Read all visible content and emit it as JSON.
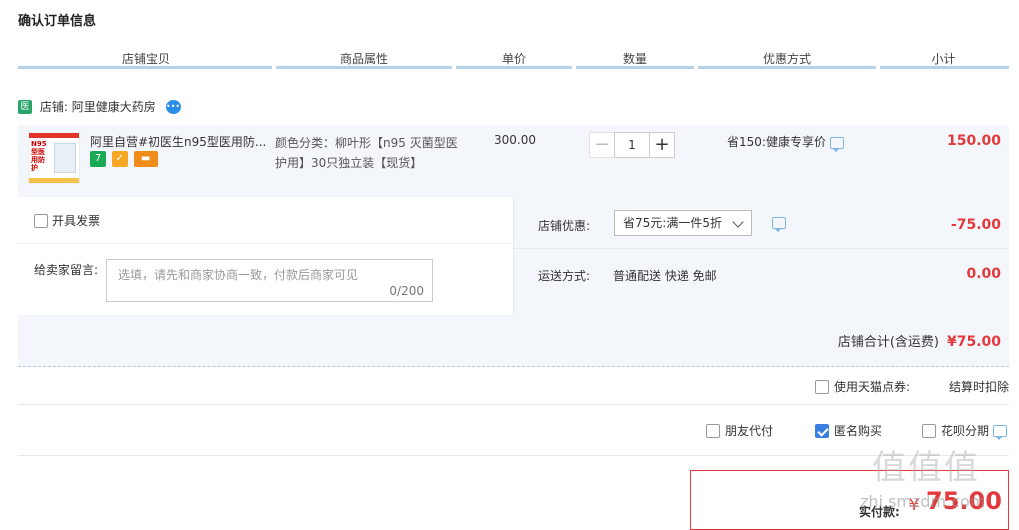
{
  "page_title": "确认订单信息",
  "columns": [
    "店铺宝贝",
    "商品属性",
    "单价",
    "数量",
    "优惠方式",
    "小计"
  ],
  "shop": {
    "badge": "医",
    "label": "店铺:",
    "name": "阿里健康大药房"
  },
  "item": {
    "title": "阿里自营#初医生n95型医用防...",
    "thumb_text": "N95型医用防护",
    "attributes": "颜色分类：柳叶形【n95 灭菌型医护用】30只独立装【现货】",
    "price": "300.00",
    "quantity": "1",
    "minus": "−",
    "plus": "+",
    "promotion": "省150:健康专享价",
    "subtotal": "150.00",
    "icons": [
      "7",
      "✓",
      "▬"
    ]
  },
  "invoice": {
    "label": "开具发票"
  },
  "memo": {
    "label": "给卖家留言:",
    "placeholder": "选填，请先和商家协商一致，付款后商家可见",
    "count": "0/200"
  },
  "discount": {
    "label": "店铺优惠:",
    "selected": "省75元:满一件5折",
    "value": "-75.00"
  },
  "shipping": {
    "label": "运送方式:",
    "method": "普通配送 快递 免邮",
    "value": "0.00"
  },
  "shop_total": {
    "label": "店铺合计(含运费)",
    "value": "¥75.00"
  },
  "tmall_points": {
    "label": "使用天猫点券:",
    "status": "结算时扣除"
  },
  "options": {
    "friend_pay": "朋友代付",
    "anonymous": "匿名购买",
    "huabei": "花呗分期"
  },
  "payment": {
    "label": "实付款:",
    "currency": "¥",
    "value": "75.00"
  },
  "watermark": {
    "big": "值值值",
    "small": "zhi.smzdm.com"
  },
  "colors": {
    "accent": "#e4393c",
    "header_line": "#b6d1ea",
    "row_bg": "#f3f7fc",
    "checkbox_on": "#3b7fe0"
  }
}
